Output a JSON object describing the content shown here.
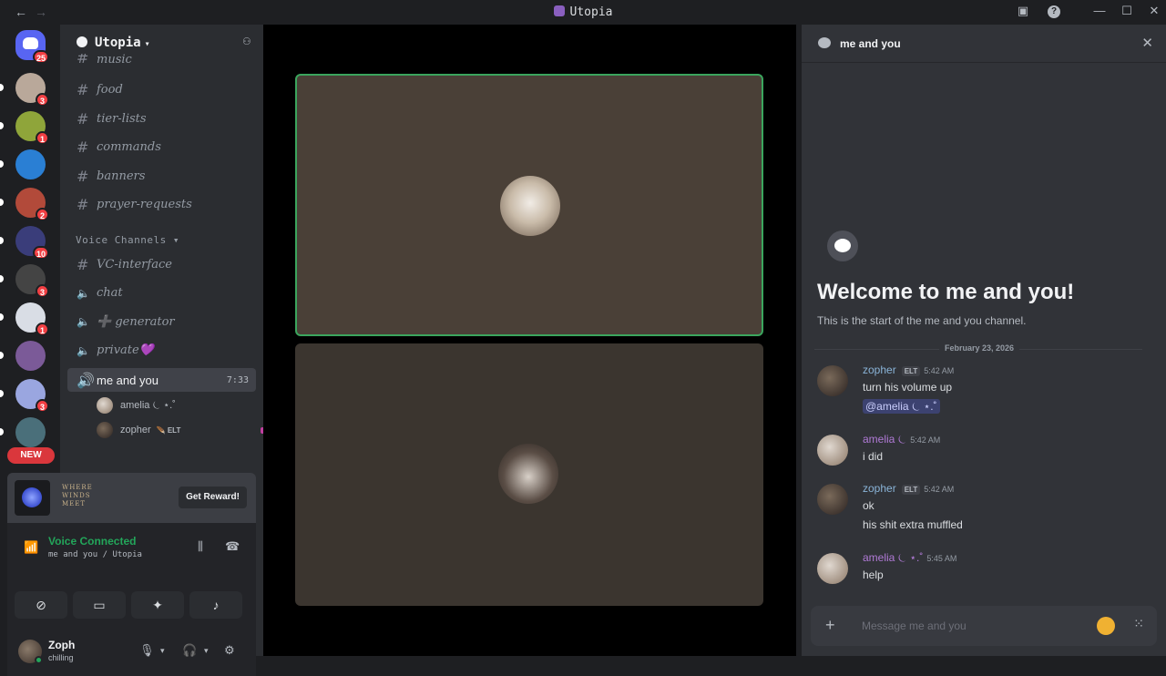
{
  "titlebar": {
    "title": "Utopia",
    "back": "←",
    "forward": "→",
    "help": "?",
    "minimize": "—",
    "maximize": "☐",
    "close": "✕"
  },
  "rail": {
    "home_badge": "25",
    "servers": [
      {
        "name": "server-1",
        "badge": "3",
        "color": "#b9a89a"
      },
      {
        "name": "server-2",
        "badge": "1",
        "color": "#8fa53a"
      },
      {
        "name": "server-3",
        "badge": "",
        "color": "#2a7fd4"
      },
      {
        "name": "server-4",
        "badge": "2",
        "color": "#b24a3a"
      },
      {
        "name": "server-5",
        "badge": "10",
        "color": "#3a3d7a"
      },
      {
        "name": "server-6",
        "badge": "3",
        "color": "#444"
      },
      {
        "name": "server-7",
        "badge": "1",
        "color": "#d9dde5"
      },
      {
        "name": "server-8",
        "badge": "",
        "color": "#7b5a98"
      },
      {
        "name": "server-9",
        "badge": "3",
        "color": "#9aa6e0"
      },
      {
        "name": "server-10",
        "badge": "",
        "color": "#4a6f7a"
      }
    ],
    "new_label": "NEW"
  },
  "sidebar": {
    "server_name": "Utopia",
    "text_channels": [
      "music",
      "food",
      "tier-lists",
      "commands",
      "banners",
      "prayer-requests"
    ],
    "voice_category": "Voice Channels",
    "voice_channels": [
      {
        "name": "VC-interface",
        "sym": "#"
      },
      {
        "name": "chat",
        "sym": "🔈"
      },
      {
        "name": "➕ generator",
        "sym": "🔈"
      },
      {
        "name": "private💜",
        "sym": "🔈"
      }
    ],
    "active_channel": {
      "name": "me and you",
      "time": "7:33"
    },
    "voice_users": [
      {
        "name": "amelia ⏾ ⋆.˚",
        "tag": ""
      },
      {
        "name": "zopher",
        "tag": "ELT"
      }
    ]
  },
  "reward": {
    "logo": "WHERE WINDS MEET",
    "button": "Get Reward!"
  },
  "voice": {
    "status": "Voice Connected",
    "sub": "me and you / Utopia"
  },
  "user": {
    "name": "Zoph",
    "status": "chilling"
  },
  "chat": {
    "channel": "me and you",
    "welcome_title": "Welcome to me and you!",
    "welcome_sub": "This is the start of the me and you channel.",
    "date": "February 23, 2026",
    "messages": [
      {
        "author": "zopher",
        "tag": "ELT",
        "time": "5:42 AM",
        "lines": [
          "turn his volume up"
        ],
        "mention": "@amelia ⏾ ⋆.˚",
        "color": "zoph"
      },
      {
        "author": "amelia ⏾",
        "tag": "",
        "time": "5:42 AM",
        "lines": [
          "i did"
        ],
        "mention": "",
        "color": "amelia"
      },
      {
        "author": "zopher",
        "tag": "ELT",
        "time": "5:42 AM",
        "lines": [
          "ok",
          "his shit extra muffled"
        ],
        "mention": "",
        "color": "zoph"
      },
      {
        "author": "amelia ⏾ ⋆.˚",
        "tag": "",
        "time": "5:45 AM",
        "lines": [
          "help"
        ],
        "mention": "",
        "color": "amelia"
      }
    ],
    "composer_placeholder": "Message me and you"
  }
}
